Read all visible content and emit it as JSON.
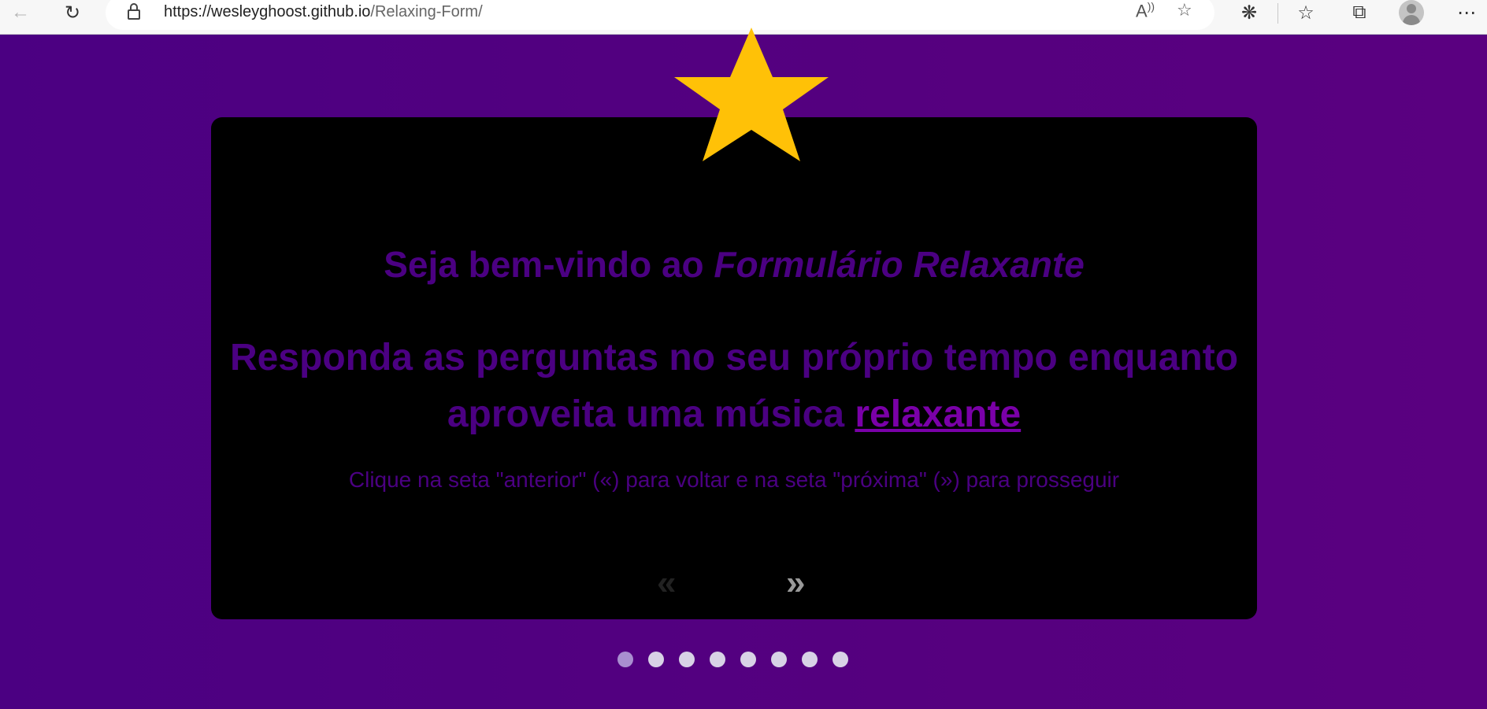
{
  "browser": {
    "url_host": "https://wesleyghoost.github.io",
    "url_path": "/Relaxing-Form/"
  },
  "card": {
    "title_prefix": "Seja bem-vindo ao ",
    "title_emphasis": "Formulário Relaxante",
    "subtitle_text": "Responda as perguntas no seu próprio tempo enquanto aproveita uma música ",
    "subtitle_link": "relaxante",
    "instruction": "Clique na seta \"anterior\" («) para voltar e na seta \"próxima\" (») para prosseguir",
    "prev_arrow": "«",
    "next_arrow": "»"
  },
  "pagination": {
    "total_dots": 8,
    "active_index": 0
  },
  "colors": {
    "background": "#4b0082",
    "card": "#000000",
    "text": "#4b0082",
    "star": "#ffc107",
    "dot": "#d8d2e6",
    "dot_active": "#a98fd0"
  },
  "icons": {
    "back": "arrow-left-icon",
    "reload": "reload-icon",
    "lock": "lock-icon",
    "read_aloud": "read-aloud-icon",
    "add_favorite": "add-favorite-icon",
    "extensions": "extensions-icon",
    "favorites": "favorites-icon",
    "collections": "collections-icon",
    "profile": "profile-avatar-icon",
    "menu": "more-options-icon",
    "decoration": "star-icon"
  }
}
